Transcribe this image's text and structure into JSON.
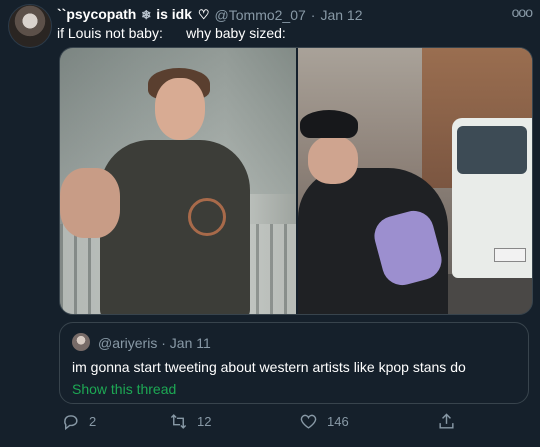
{
  "tweet": {
    "display_name_part1": "``psycopath",
    "display_name_snow": "❄",
    "display_name_part2": "is idk",
    "display_name_heart": "♡",
    "handle": "@Tommo2_07",
    "separator": "·",
    "date": "Jan 12",
    "more_icon": "ooo",
    "text": "if Louis not baby:      why baby sized:"
  },
  "quoted_tweet": {
    "handle": "@ariyeris",
    "separator": "·",
    "date": "Jan 11",
    "text": "im gonna start tweeting about western artists like kpop stans do",
    "show_thread": "Show this thread"
  },
  "actions": {
    "reply_count": "2",
    "retweet_count": "12",
    "like_count": "146"
  },
  "icons": {
    "avatar": "avatar-photo",
    "more": "more-icon",
    "reply": "reply-icon",
    "retweet": "retweet-icon",
    "like": "heart-icon",
    "share": "share-icon"
  },
  "colors": {
    "background": "#15202b",
    "secondary_text": "#8899a6",
    "link": "#1da854",
    "border": "#38444d"
  }
}
